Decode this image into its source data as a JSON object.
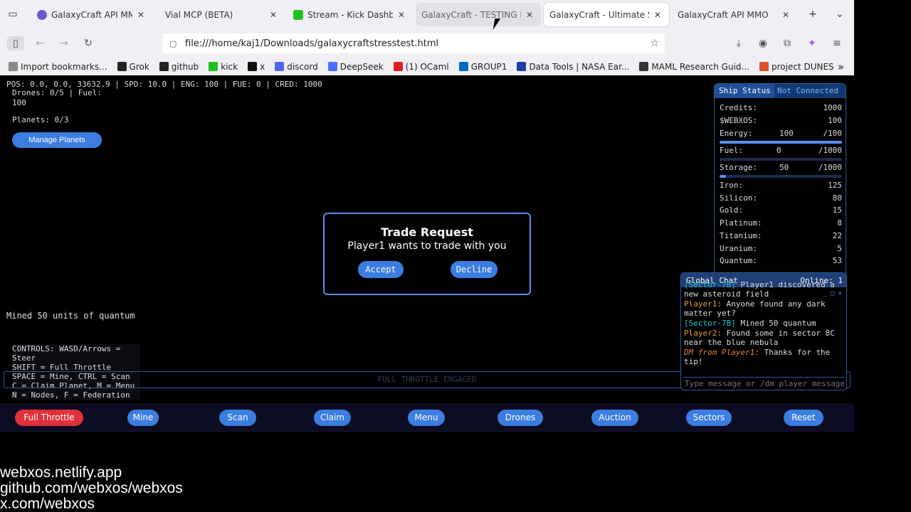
{
  "tabs": [
    {
      "title": "GalaxyCraft API MMO (",
      "favicon": "galaxycraft",
      "state": "normal"
    },
    {
      "title": "Vial MCP (BETA)",
      "favicon": "none",
      "state": "normal"
    },
    {
      "title": "Stream - Kick Dashboar",
      "favicon": "kick",
      "state": "normal"
    },
    {
      "title": "GalaxyCraft - TESTING M",
      "favicon": "none",
      "state": "hover"
    },
    {
      "title": "GalaxyCraft - Ultimate Spa",
      "favicon": "none",
      "state": "active"
    },
    {
      "title": "GalaxyCraft API MMO",
      "favicon": "none",
      "state": "normal"
    }
  ],
  "url": "file:///home/kaj1/Downloads/galaxycraftstresstest.html",
  "bookmarks": [
    {
      "label": "Import bookmarks...",
      "icon": "import-icon"
    },
    {
      "label": "Grok",
      "icon": "grok-icon"
    },
    {
      "label": "github",
      "icon": "github-icon"
    },
    {
      "label": "kick",
      "icon": "kick-icon"
    },
    {
      "label": "x",
      "icon": "x-icon"
    },
    {
      "label": "discord",
      "icon": "discord-icon"
    },
    {
      "label": "DeepSeek",
      "icon": "deepseek-icon"
    },
    {
      "label": "(1) OCaml",
      "icon": "youtube-icon"
    },
    {
      "label": "GROUP1",
      "icon": "linkedin-icon"
    },
    {
      "label": "Data Tools | NASA Ear...",
      "icon": "nasa-icon"
    },
    {
      "label": "MAML Research Guid...",
      "icon": "doc-icon"
    },
    {
      "label": "project DUNES",
      "icon": "star-icon"
    }
  ],
  "hud": {
    "top": "POS: 0.0, 0.0, 33632.9 | SPD: 10.0 | ENG: 100 | FUE: 0 | CRED: 1000",
    "drones": "Drones: 0/5 | Fuel: 100",
    "planets": "Planets: 0/3",
    "manage_planets": "Manage Planets",
    "mined": "Mined 50 units of quantum",
    "controls": [
      "CONTROLS: WASD/Arrows = Steer",
      "SHIFT = Full Throttle",
      "SPACE = Mine, CTRL = Scan",
      "C = Claim Planet, M = Menu",
      "N = Nodes, F = Federation"
    ],
    "throttle": "FULL THROTTLE ENGAGED"
  },
  "trade": {
    "title": "Trade Request",
    "body": "Player1 wants to trade with you",
    "accept": "Accept",
    "decline": "Decline"
  },
  "ship": {
    "title": "Ship Status",
    "connection": "Not Connected",
    "credits_label": "Credits:",
    "credits": "1000",
    "webxos_label": "$WEBXOS:",
    "webxos": "100",
    "energy_label": "Energy:",
    "energy": "100",
    "energy_max": "/100",
    "energy_frac": 1.0,
    "fuel_label": "Fuel:",
    "fuel": "0",
    "fuel_max": "/1000",
    "fuel_frac": 0.0,
    "storage_label": "Storage:",
    "storage": "50",
    "storage_max": "/1000",
    "storage_frac": 0.05,
    "resources": [
      {
        "name": "Iron:",
        "value": "125"
      },
      {
        "name": "Silicon:",
        "value": "80"
      },
      {
        "name": "Gold:",
        "value": "15"
      },
      {
        "name": "Platinum:",
        "value": "8"
      },
      {
        "name": "Titanium:",
        "value": "22"
      },
      {
        "name": "Uranium:",
        "value": "5"
      },
      {
        "name": "Quantum:",
        "value": "53"
      }
    ]
  },
  "chat": {
    "title": "Global Chat",
    "online": "Online: 1",
    "messages": [
      {
        "from": "[Sector-7B]",
        "text": " Player1 discovered a new asteroid field",
        "cls": "sys"
      },
      {
        "from": "Player1:",
        "text": " Anyone found any dark matter yet?",
        "cls": "p1"
      },
      {
        "from": "[Sector-7B]",
        "text": " Mined 50 quantum",
        "cls": "sys"
      },
      {
        "from": "Player2:",
        "text": " Found some in sector 8C near the blue nebula",
        "cls": "p2"
      },
      {
        "from": "DM from Player1:",
        "text": " Thanks for the tip!",
        "cls": "dm"
      }
    ],
    "placeholder": "Type message or /dm player message..."
  },
  "toolbar": [
    {
      "label": "Full Throttle",
      "color": "#e0303a"
    },
    {
      "label": "Mine"
    },
    {
      "label": "Scan"
    },
    {
      "label": "Claim"
    },
    {
      "label": "Menu"
    },
    {
      "label": "Drones"
    },
    {
      "label": "Auction"
    },
    {
      "label": "Sectors"
    },
    {
      "label": "Reset"
    }
  ],
  "credits": [
    "webxos.netlify.app",
    "github.com/webxos/webxos",
    "x.com/webxos"
  ]
}
